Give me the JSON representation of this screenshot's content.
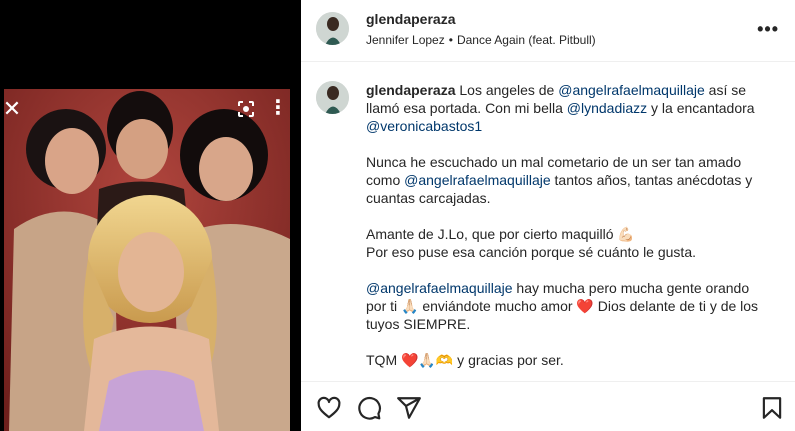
{
  "media": {
    "close_icon": "close-icon",
    "lens_icon": "google-lens-icon",
    "more_icon": "more-vertical-icon"
  },
  "header": {
    "username": "glendaperaza",
    "music_artist": "Jennifer Lopez",
    "music_separator": "•",
    "music_track": "Dance Again (feat. Pitbull)",
    "more_glyph": "•••"
  },
  "caption": {
    "username": "glendaperaza",
    "p1": [
      {
        "t": "Los angeles de "
      },
      {
        "t": "@angelrafaelmaquillaje",
        "m": true
      },
      {
        "t": " así se llamó esa portada. Con mi bella "
      },
      {
        "t": "@lyndadiazz",
        "m": true
      },
      {
        "t": " y la encantadora "
      },
      {
        "t": "@veronicabastos1",
        "m": true
      }
    ],
    "p2": [
      {
        "t": "Nunca he escuchado un mal cometario de un ser tan amado como "
      },
      {
        "t": "@angelrafaelmaquillaje",
        "m": true
      },
      {
        "t": " tantos años, tantas anécdotas y cuantas carcajadas."
      }
    ],
    "p3_line1": "Amante de J.Lo, que por cierto maquilló 💪🏻",
    "p3_line2": "Por eso puse esa canción porque sé cuánto le gusta.",
    "p4": [
      {
        "t": "@angelrafaelmaquillaje",
        "m": true
      },
      {
        "t": " hay mucha pero mucha gente orando por ti 🙏🏻 enviándote mucho amor ❤️ Dios delante de ti y de los tuyos SIEMPRE."
      }
    ],
    "p5": "TQM ❤️🙏🏻🫶 y gracias por ser."
  },
  "actions": {
    "like_icon": "heart-icon",
    "comment_icon": "comment-icon",
    "share_icon": "share-icon",
    "save_icon": "bookmark-icon"
  },
  "colors": {
    "mention": "#00376b",
    "text": "#262626",
    "border": "#efefef"
  }
}
